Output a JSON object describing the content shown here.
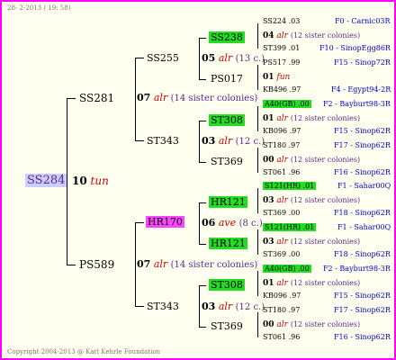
{
  "header": "28- 2-2013 ( 19: 58)",
  "footer": "Copyright 2004-2013 @ Karl Kehrle Foundation",
  "root": {
    "id": "SS284",
    "num": "10",
    "breed": "tun"
  },
  "gen1": [
    {
      "id": "SS281",
      "num": "07",
      "breed": "alr",
      "note": "(14 sister colonies)"
    },
    {
      "id": "PS589",
      "num": "07",
      "breed": "alr",
      "note": "(14 sister colonies)"
    }
  ],
  "gen2": [
    {
      "id": "SS255",
      "num": "05",
      "breed": "alr",
      "note": "(13 c.)"
    },
    {
      "id": "ST343",
      "num": "03",
      "breed": "alr",
      "note": "(12 c.)"
    },
    {
      "id": "HR170",
      "num": "06",
      "breed": "ave",
      "note": "(8 c.)"
    },
    {
      "id": "ST343",
      "num": "03",
      "breed": "alr",
      "note": "(12 c.)"
    }
  ],
  "gen3": [
    {
      "id": "SS238"
    },
    {
      "id": "PS017",
      "num": "01",
      "breed": "fun"
    },
    {
      "id": "ST308"
    },
    {
      "id": "ST369"
    },
    {
      "id": "HR121"
    },
    {
      "id": "HR121"
    },
    {
      "id": "ST308"
    },
    {
      "id": "ST369"
    }
  ],
  "gen4": [
    {
      "a": "SS224 .03",
      "b": "F0 - Carnic03R"
    },
    {
      "a": "04",
      "breed": "alr",
      "note": "(12 sister colonies)"
    },
    {
      "a": "ST399 .01",
      "b": "F10 - SinopEgg86R"
    },
    {
      "a": "PS517 .99",
      "b": "F15 - Sinop72R"
    },
    {
      "a": "01",
      "breed": "fun"
    },
    {
      "a": "KB496 .97",
      "b": "F4 - Egypt94-2R"
    },
    {
      "a": "A40(GB) .00",
      "b": "F2 - Bayburt98-3R"
    },
    {
      "a": "01",
      "breed": "alr",
      "note": "(12 sister colonies)"
    },
    {
      "a": "KB096 .97",
      "b": "F15 - Sinop62R"
    },
    {
      "a": "ST180 .97",
      "b": "F17 - Sinop62R"
    },
    {
      "a": "00",
      "breed": "alr",
      "note": "(12 sister colonies)"
    },
    {
      "a": "ST061 .96",
      "b": "F16 - Sinop62R"
    },
    {
      "a": "S121(HR) .01",
      "b": "F1 - Sahar00Q"
    },
    {
      "a": "03",
      "breed": "alr",
      "note": "(12 sister colonies)"
    },
    {
      "a": "ST369 .00",
      "b": "F18 - Sinop62R"
    },
    {
      "a": "S121(HR) .01",
      "b": "F1 - Sahar00Q"
    },
    {
      "a": "03",
      "breed": "alr",
      "note": "(12 sister colonies)"
    },
    {
      "a": "ST369 .00",
      "b": "F18 - Sinop62R"
    },
    {
      "a": "A40(GB) .00",
      "b": "F2 - Bayburt98-3R"
    },
    {
      "a": "01",
      "breed": "alr",
      "note": "(12 sister colonies)"
    },
    {
      "a": "KB096 .97",
      "b": "F15 - Sinop62R"
    },
    {
      "a": "ST180 .97",
      "b": "F17 - Sinop62R"
    },
    {
      "a": "00",
      "breed": "alr",
      "note": "(12 sister colonies)"
    },
    {
      "a": "ST061 .96",
      "b": "F16 - Sinop62R"
    }
  ],
  "colors": {
    "border": "#ff00ff",
    "green": "#22dd22",
    "pink": "#ff44ff",
    "lavender": "#ccccff"
  }
}
